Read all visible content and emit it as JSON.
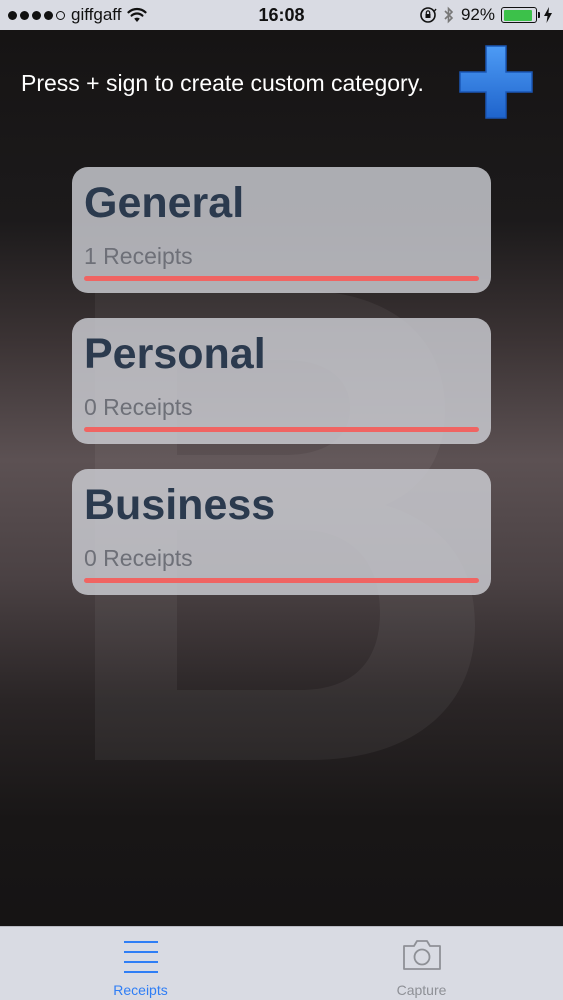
{
  "status_bar": {
    "carrier": "giffgaff",
    "time": "16:08",
    "battery_percent": "92%",
    "battery_level": 0.92,
    "icons": [
      "signal-dots-icon",
      "wifi-icon",
      "orientation-lock-icon",
      "bluetooth-icon",
      "battery-icon",
      "charging-bolt-icon"
    ]
  },
  "header": {
    "hint": "Press + sign to create custom category.",
    "add_icon": "plus-icon",
    "add_color": "#2f7ee8"
  },
  "categories": [
    {
      "title": "General",
      "count": "1 Receipts"
    },
    {
      "title": "Personal",
      "count": "0 Receipts"
    },
    {
      "title": "Business",
      "count": "0 Receipts"
    }
  ],
  "colors": {
    "card_title": "#2b3a4e",
    "card_bar": "#f06462",
    "tab_active": "#2f7ef5",
    "tab_inactive": "#8e9096"
  },
  "tab_bar": {
    "tabs": [
      {
        "label": "Receipts",
        "icon": "list-icon",
        "active": true
      },
      {
        "label": "Capture",
        "icon": "camera-icon",
        "active": false
      }
    ]
  }
}
